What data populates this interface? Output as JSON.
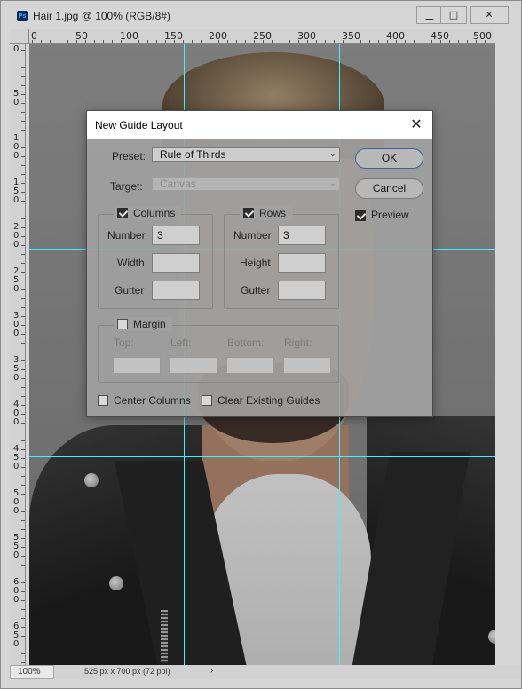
{
  "window": {
    "title": "Hair 1.jpg @ 100% (RGB/8#)",
    "app_icon": "Ps",
    "minimize_glyph": "▁",
    "maximize_glyph": "□",
    "close_glyph": "✕"
  },
  "rulers": {
    "top_labels": [
      "0",
      "50",
      "100",
      "150",
      "200",
      "250",
      "300",
      "350",
      "400",
      "450",
      "500"
    ],
    "left_labels": [
      "0",
      "50",
      "100",
      "150",
      "200",
      "250",
      "300",
      "350",
      "400",
      "450",
      "500",
      "550",
      "600",
      "650"
    ]
  },
  "status": {
    "zoom": "100%",
    "doc_info": "525 px x 700 px (72 ppi)",
    "arrow": "›"
  },
  "dialog": {
    "title": "New Guide Layout",
    "close_glyph": "✕",
    "preset": {
      "label": "Preset:",
      "value": "Rule of Thirds"
    },
    "target": {
      "label": "Target:",
      "value": "Canvas",
      "enabled": false
    },
    "buttons": {
      "ok": "OK",
      "cancel": "Cancel"
    },
    "preview": {
      "label": "Preview",
      "checked": true
    },
    "columns": {
      "label": "Columns",
      "checked": true,
      "number_label": "Number",
      "number_value": "3",
      "width_label": "Width",
      "width_value": "",
      "gutter_label": "Gutter",
      "gutter_value": ""
    },
    "rows": {
      "label": "Rows",
      "checked": true,
      "number_label": "Number",
      "number_value": "3",
      "height_label": "Height",
      "height_value": "",
      "gutter_label": "Gutter",
      "gutter_value": ""
    },
    "margin": {
      "label": "Margin",
      "checked": false,
      "top_label": "Top:",
      "left_label": "Left:",
      "bottom_label": "Bottom:",
      "right_label": "Right:"
    },
    "center_columns": {
      "label": "Center Columns",
      "checked": false
    },
    "clear_guides": {
      "label": "Clear Existing Guides",
      "checked": false
    }
  },
  "colors": {
    "guide": "#3ff0ff",
    "ok_border": "#4a5c8c"
  }
}
